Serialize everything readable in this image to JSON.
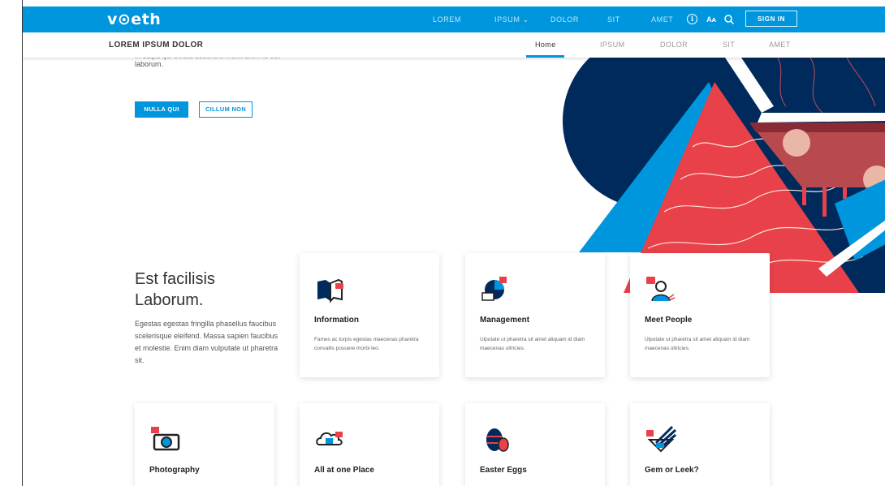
{
  "header": {
    "logo": "v⊙eth",
    "nav": [
      "LOREM",
      "IPSUM ⌄",
      "DOLOR",
      "SIT",
      "AMET"
    ],
    "sign_in": "SIGN IN",
    "icons": [
      "info-icon",
      "text-size-icon",
      "search-icon"
    ]
  },
  "subheader": {
    "title": "LOREM IPSUM DOLOR",
    "nav": [
      "Home",
      "IPSUM",
      "DOLOR",
      "SIT",
      "AMET"
    ]
  },
  "hero": {
    "text_cut": "in culpa qui officia deserunt mollit anim id est",
    "text_end": "laborum.",
    "primary_button": "NULLA QUI",
    "secondary_button": "CILLUM NON"
  },
  "section": {
    "title_line1": "Est facilisis",
    "title_line2": "Laborum.",
    "description": "Egestas egestas fringilla phasellus faucibus scelerisque eleifend. Massa sapien faucibus et molestie. Enim diam vulputate ut pharetra sit."
  },
  "cards": [
    {
      "title": "Information",
      "desc": "Fames ac turpis egestas maecenas pharetra convallis posuere morbi leo."
    },
    {
      "title": "Management",
      "desc": "Ulputate ut pharetra sit amet aliquam id diam maecenas ultricies."
    },
    {
      "title": "Meet People",
      "desc": "Ulputate ut pharetra sit amet aliquam id diam maecenas ultricies."
    },
    {
      "title": "Photography",
      "desc": ""
    },
    {
      "title": "All at one Place",
      "desc": ""
    },
    {
      "title": "Easter Eggs",
      "desc": ""
    },
    {
      "title": "Gem or Leek?",
      "desc": ""
    }
  ],
  "colors": {
    "brand": "#0096de",
    "navy": "#002a5c",
    "red": "#e8414a",
    "dark": "#222222"
  }
}
